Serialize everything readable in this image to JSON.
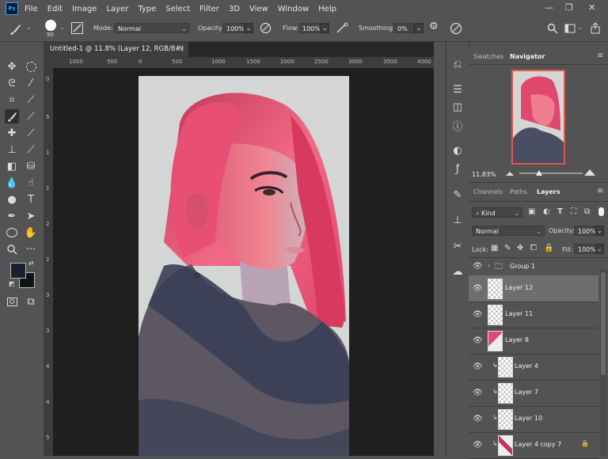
{
  "app": {
    "logo": "Ps"
  },
  "menu": [
    "File",
    "Edit",
    "Image",
    "Layer",
    "Type",
    "Select",
    "Filter",
    "3D",
    "View",
    "Window",
    "Help"
  ],
  "window_controls": {
    "minimize": "—",
    "restore": "❐",
    "close": "✕"
  },
  "options": {
    "brush_size": "90",
    "mode_label": "Mode:",
    "mode_value": "Normal",
    "opacity_label": "Opacity:",
    "opacity_value": "100%",
    "flow_label": "Flow:",
    "flow_value": "100%",
    "smoothing_label": "Smoothing:",
    "smoothing_value": "0%"
  },
  "document": {
    "tab_title": "Untitled-1 @ 11.8% (Layer 12, RGB/8#) *",
    "close": "×"
  },
  "rulers": {
    "horizontal": [
      "1000",
      "500",
      "0",
      "500",
      "1000",
      "1500",
      "2000",
      "2500",
      "3000",
      "3500",
      "4000"
    ],
    "vertical": [
      "0",
      "5",
      "1",
      "1",
      "2",
      "2",
      "3",
      "3",
      "4",
      "4",
      "5"
    ]
  },
  "colors": {
    "foreground": "#1a2030",
    "background": "#0f1418",
    "accent_nav": "#e2574c"
  },
  "nav_panel": {
    "tabs": [
      "Swatches",
      "Navigator"
    ],
    "active_tab": "Navigator",
    "zoom": "11.83%"
  },
  "layers_panel": {
    "tabs": [
      "Channels",
      "Paths",
      "Layers"
    ],
    "active_tab": "Layers",
    "filter": "Kind",
    "blend_mode": "Normal",
    "opacity_label": "Opacity:",
    "opacity_value": "100%",
    "lock_label": "Lock:",
    "fill_label": "Fill:",
    "fill_value": "100%",
    "layers": [
      {
        "name": "Group 1",
        "type": "group",
        "selected": false
      },
      {
        "name": "Layer 12",
        "type": "layer",
        "selected": true
      },
      {
        "name": "Layer 11",
        "type": "layer",
        "selected": false
      },
      {
        "name": "Layer 8",
        "type": "layer",
        "selected": false
      },
      {
        "name": "Layer 4",
        "type": "clip",
        "selected": false
      },
      {
        "name": "Layer 7",
        "type": "clip",
        "selected": false
      },
      {
        "name": "Layer 10",
        "type": "clip",
        "selected": false
      },
      {
        "name": "Layer 4 copy 7",
        "type": "clip",
        "selected": false
      }
    ]
  }
}
